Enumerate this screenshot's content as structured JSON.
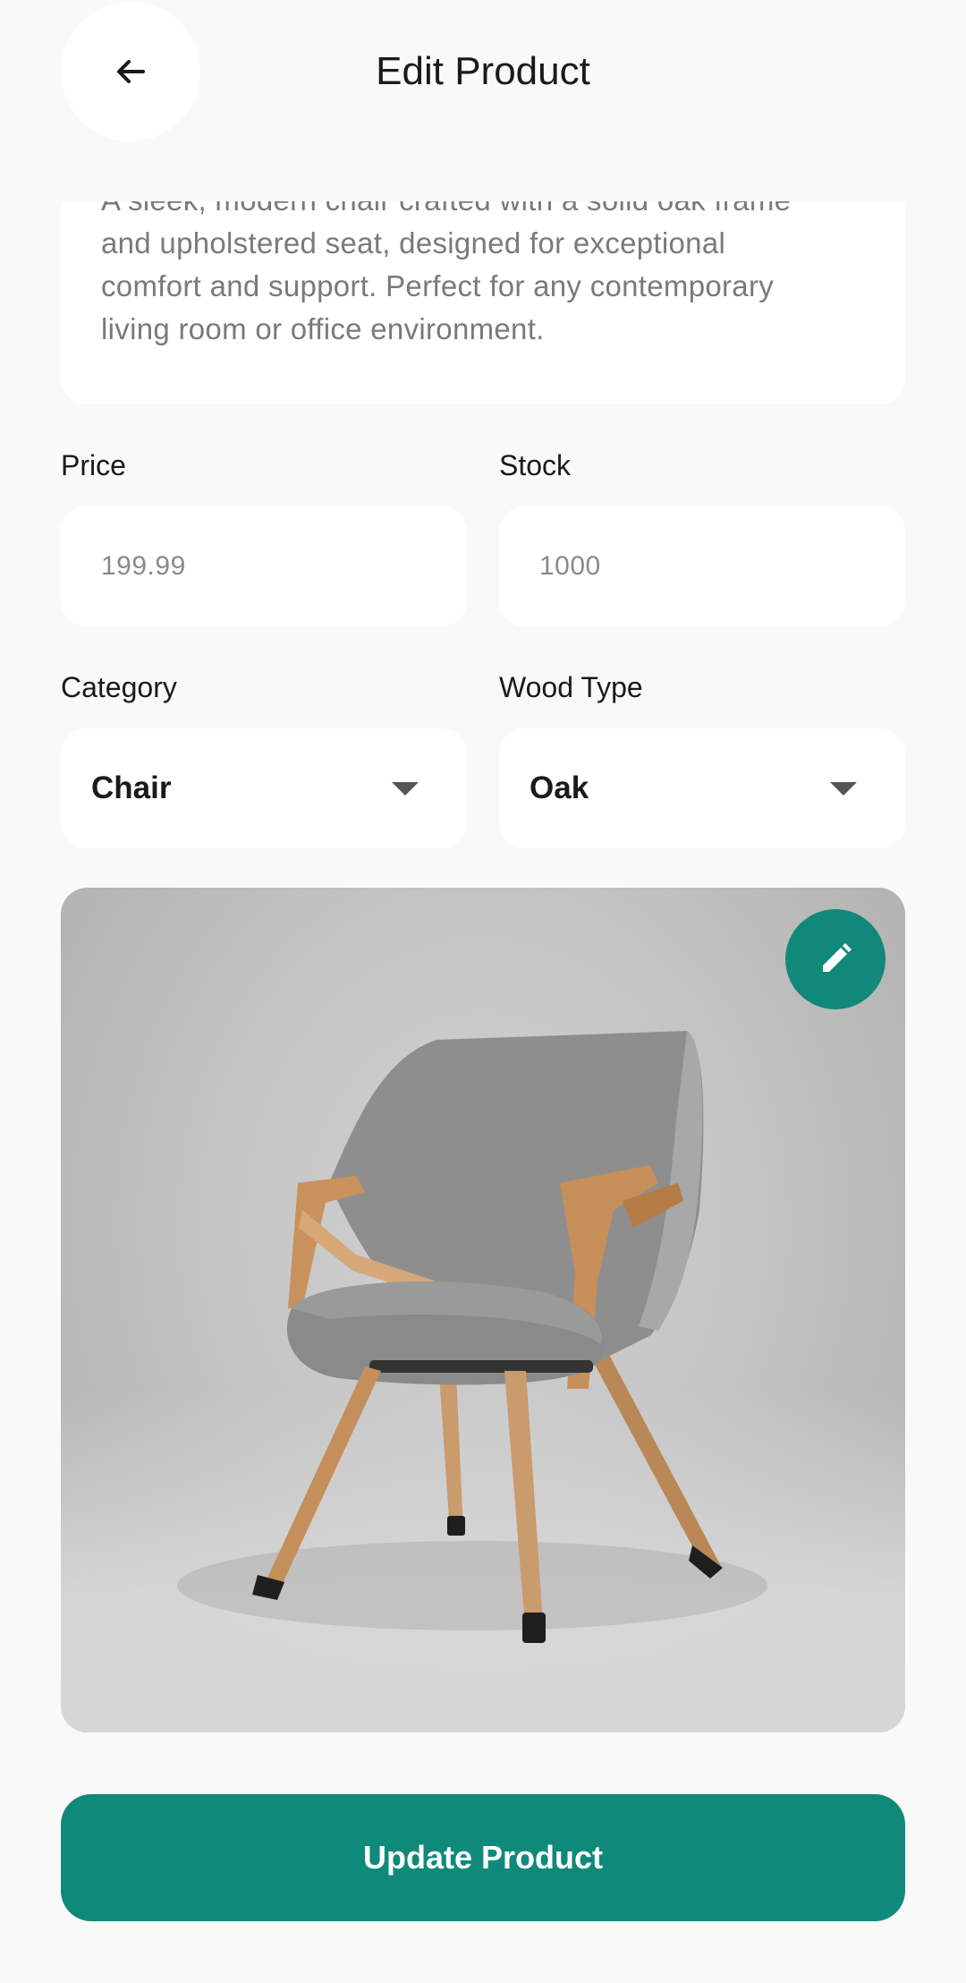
{
  "header": {
    "title": "Edit Product",
    "back_icon": "arrow-left-icon"
  },
  "form": {
    "description": "A sleek, modern chair crafted with a solid oak frame and upholstered seat, designed for exceptional comfort and support. Perfect for any contemporary living room or office environment.",
    "price_label": "Price",
    "price_value": "199.99",
    "stock_label": "Stock",
    "stock_value": "1000",
    "category_label": "Category",
    "category_value": "Chair",
    "wood_type_label": "Wood Type",
    "wood_type_value": "Oak"
  },
  "image": {
    "edit_icon": "pencil-icon",
    "subject": "chair"
  },
  "actions": {
    "update_label": "Update Product"
  },
  "colors": {
    "accent": "#0f8a7a",
    "background": "#f9f9f9",
    "card": "#ffffff"
  }
}
